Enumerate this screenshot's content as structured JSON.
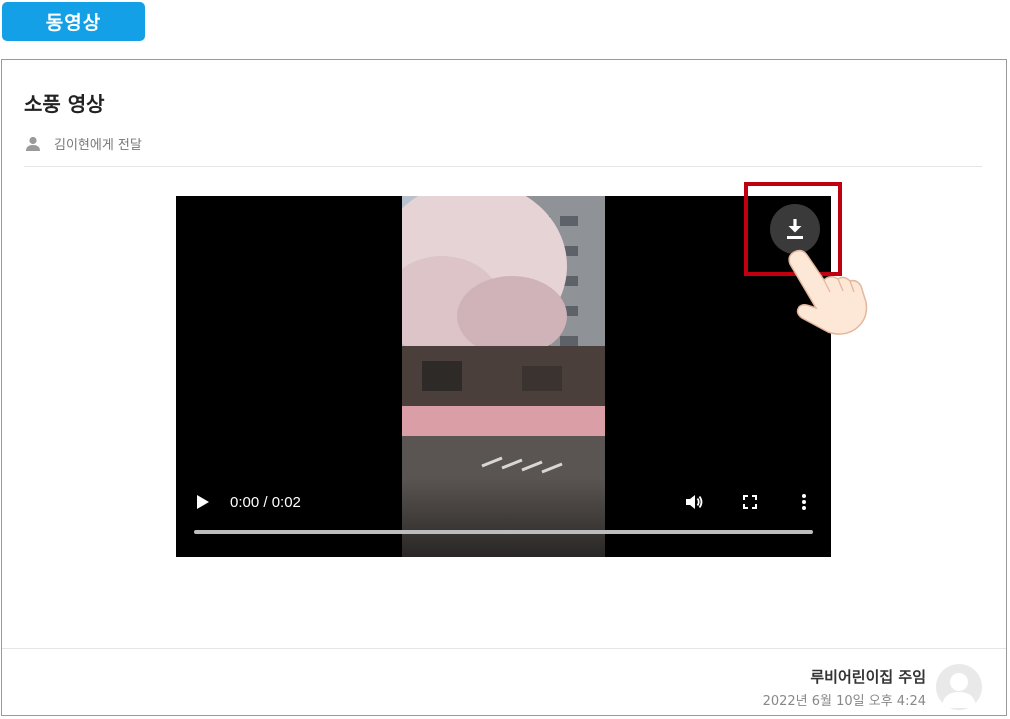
{
  "tag": {
    "label": "동영상"
  },
  "post": {
    "title": "소풍 영상",
    "recipient": "김이현에게 전달"
  },
  "video": {
    "time": "0:00 / 0:02",
    "progress": 0
  },
  "footer": {
    "author": "루비어린이집 주임",
    "date": "2022년 6월 10일 오후 4:24"
  },
  "icons": {
    "recipient": "person-icon",
    "play": "play-icon",
    "volume": "volume-icon",
    "fullscreen": "fullscreen-icon",
    "more": "more-vert-icon",
    "download": "download-icon",
    "pointer": "hand-pointer-icon",
    "avatar": "avatar-icon"
  },
  "colors": {
    "tag_bg": "#14a0e6",
    "highlight": "#c00010"
  }
}
